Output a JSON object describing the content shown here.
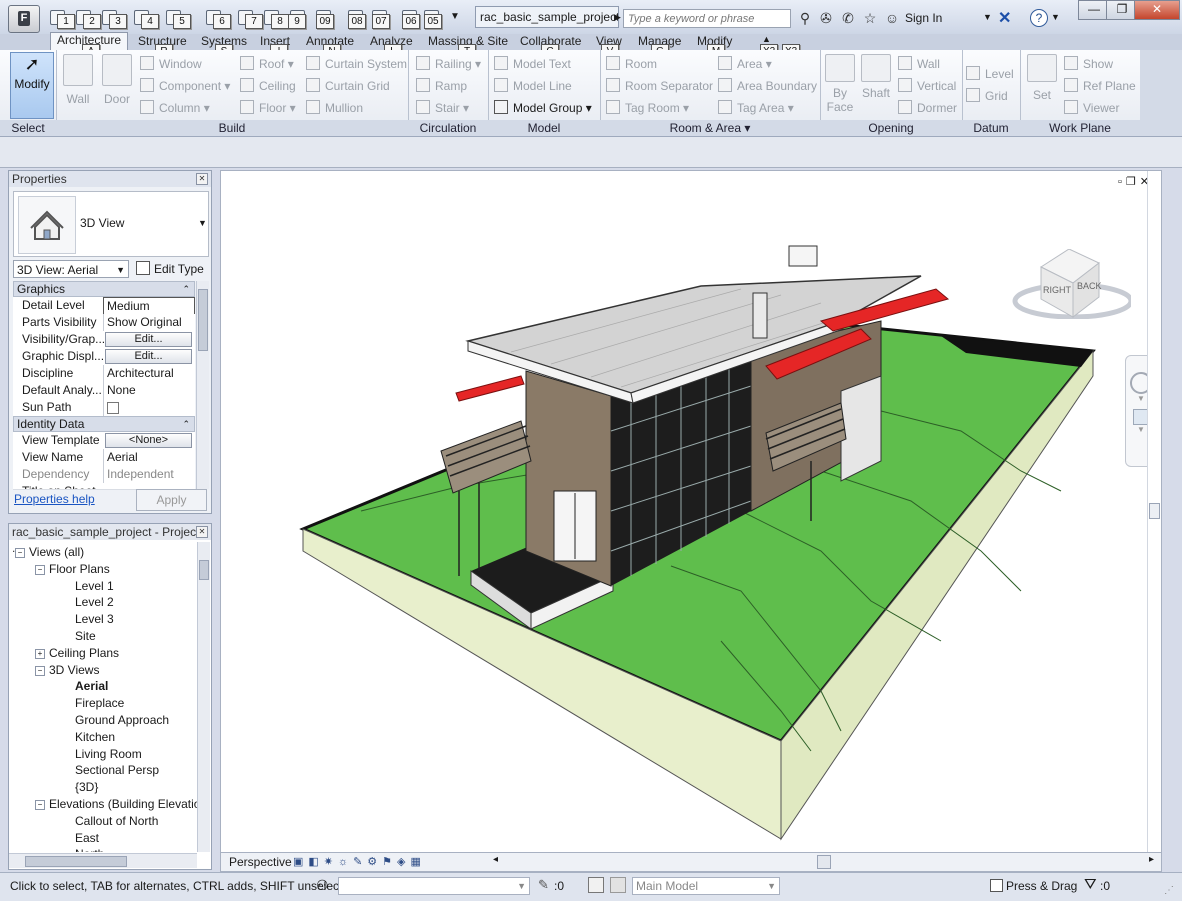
{
  "titlebar": {
    "app_menu_label": "F",
    "document_title": "rac_basic_sample_project...",
    "search_placeholder": "Type a keyword or phrase",
    "sign_in": "Sign In",
    "help_label": "?",
    "qat_keytips": [
      "1",
      "2",
      "3",
      "4",
      "5",
      "6",
      "7",
      "8",
      "9",
      "09",
      "08",
      "07",
      "06",
      "05"
    ]
  },
  "ribbon_tabs": [
    "Architecture",
    "Structure",
    "Systems",
    "Insert",
    "Annotate",
    "Analyze",
    "Massing & Site",
    "Collaborate",
    "View",
    "Manage",
    "Modify"
  ],
  "ribbon_tab_keytips": [
    "A",
    "R",
    "S",
    "I",
    "N",
    "L",
    "T",
    "C",
    "V",
    "G",
    "M",
    "X2",
    "X3"
  ],
  "panels": {
    "select": {
      "title": "Select",
      "modify": "Modify"
    },
    "build": {
      "title": "Build",
      "wall": "Wall",
      "door": "Door",
      "window": "Window",
      "component": "Component",
      "column": "Column",
      "roof": "Roof",
      "ceiling": "Ceiling",
      "floor": "Floor",
      "curtain_system": "Curtain  System",
      "curtain_grid": "Curtain  Grid",
      "mullion": "Mullion"
    },
    "circulation": {
      "title": "Circulation",
      "railing": "Railing",
      "ramp": "Ramp",
      "stair": "Stair"
    },
    "model": {
      "title": "Model",
      "model_text": "Model  Text",
      "model_line": "Model  Line",
      "model_group": "Model  Group"
    },
    "room_area": {
      "title": "Room & Area",
      "room": "Room",
      "room_separator": "Room  Separator",
      "tag_room": "Tag  Room",
      "area": "Area",
      "area_boundary": "Area  Boundary",
      "tag_area": "Tag  Area"
    },
    "opening": {
      "title": "Opening",
      "by_face": "By\nFace",
      "shaft": "Shaft",
      "wall": "Wall",
      "vertical": "Vertical",
      "dormer": "Dormer"
    },
    "datum": {
      "title": "Datum",
      "level": "Level",
      "grid": "Grid"
    },
    "work_plane": {
      "title": "Work Plane",
      "set": "Set",
      "show": "Show",
      "ref_plane": "Ref  Plane",
      "viewer": "Viewer"
    }
  },
  "properties": {
    "title": "Properties",
    "type_name": "3D View",
    "view_selector": "3D View: Aerial",
    "edit_type": "Edit Type",
    "sections": [
      "Graphics",
      "Identity Data"
    ],
    "graphics_rows": [
      {
        "key": "Detail Level",
        "value": "Medium"
      },
      {
        "key": "Parts Visibility",
        "value": "Show Original"
      },
      {
        "key": "Visibility/Grap...",
        "value": "Edit..."
      },
      {
        "key": "Graphic Displ...",
        "value": "Edit..."
      },
      {
        "key": "Discipline",
        "value": "Architectural"
      },
      {
        "key": "Default Analy...",
        "value": "None"
      },
      {
        "key": "Sun Path",
        "value": ""
      }
    ],
    "identity_rows": [
      {
        "key": "View Template",
        "value": "<None>"
      },
      {
        "key": "View Name",
        "value": "Aerial"
      },
      {
        "key": "Dependency",
        "value": "Independent"
      },
      {
        "key": "Title on Sheet",
        "value": ""
      }
    ],
    "help_link": "Properties help",
    "apply": "Apply"
  },
  "browser": {
    "title": "rac_basic_sample_project - Project ...",
    "nodes": [
      {
        "label": "Views (all)",
        "level": 0
      },
      {
        "label": "Floor Plans",
        "level": 1
      },
      {
        "label": "Level 1",
        "level": 2
      },
      {
        "label": "Level 2",
        "level": 2
      },
      {
        "label": "Level 3",
        "level": 2
      },
      {
        "label": "Site",
        "level": 2
      },
      {
        "label": "Ceiling Plans",
        "level": 1
      },
      {
        "label": "3D Views",
        "level": 1
      },
      {
        "label": "Aerial",
        "level": 2
      },
      {
        "label": "Fireplace",
        "level": 2
      },
      {
        "label": "Ground Approach",
        "level": 2
      },
      {
        "label": "Kitchen",
        "level": 2
      },
      {
        "label": "Living Room",
        "level": 2
      },
      {
        "label": "Sectional Persp",
        "level": 2
      },
      {
        "label": "{3D}",
        "level": 2
      },
      {
        "label": "Elevations (Building Elevation)",
        "level": 1
      },
      {
        "label": "Callout of North",
        "level": 2
      },
      {
        "label": "East",
        "level": 2
      },
      {
        "label": "North",
        "level": 2
      }
    ]
  },
  "viewcube": {
    "right": "RIGHT",
    "back": "BACK"
  },
  "view_control": {
    "projection": "Perspective"
  },
  "status": {
    "message": "Click to select, TAB for alternates, CTRL adds, SHIFT unselects.",
    "count": ":0",
    "workset": "Main Model",
    "press_drag": "Press & Drag",
    "filter_count": ":0"
  },
  "colors": {
    "grass": "#5fbe4c",
    "roof": "#d3d3d3",
    "accent": "#e52626",
    "siding": "#8a7a67",
    "glass": "#1d1d1d"
  }
}
